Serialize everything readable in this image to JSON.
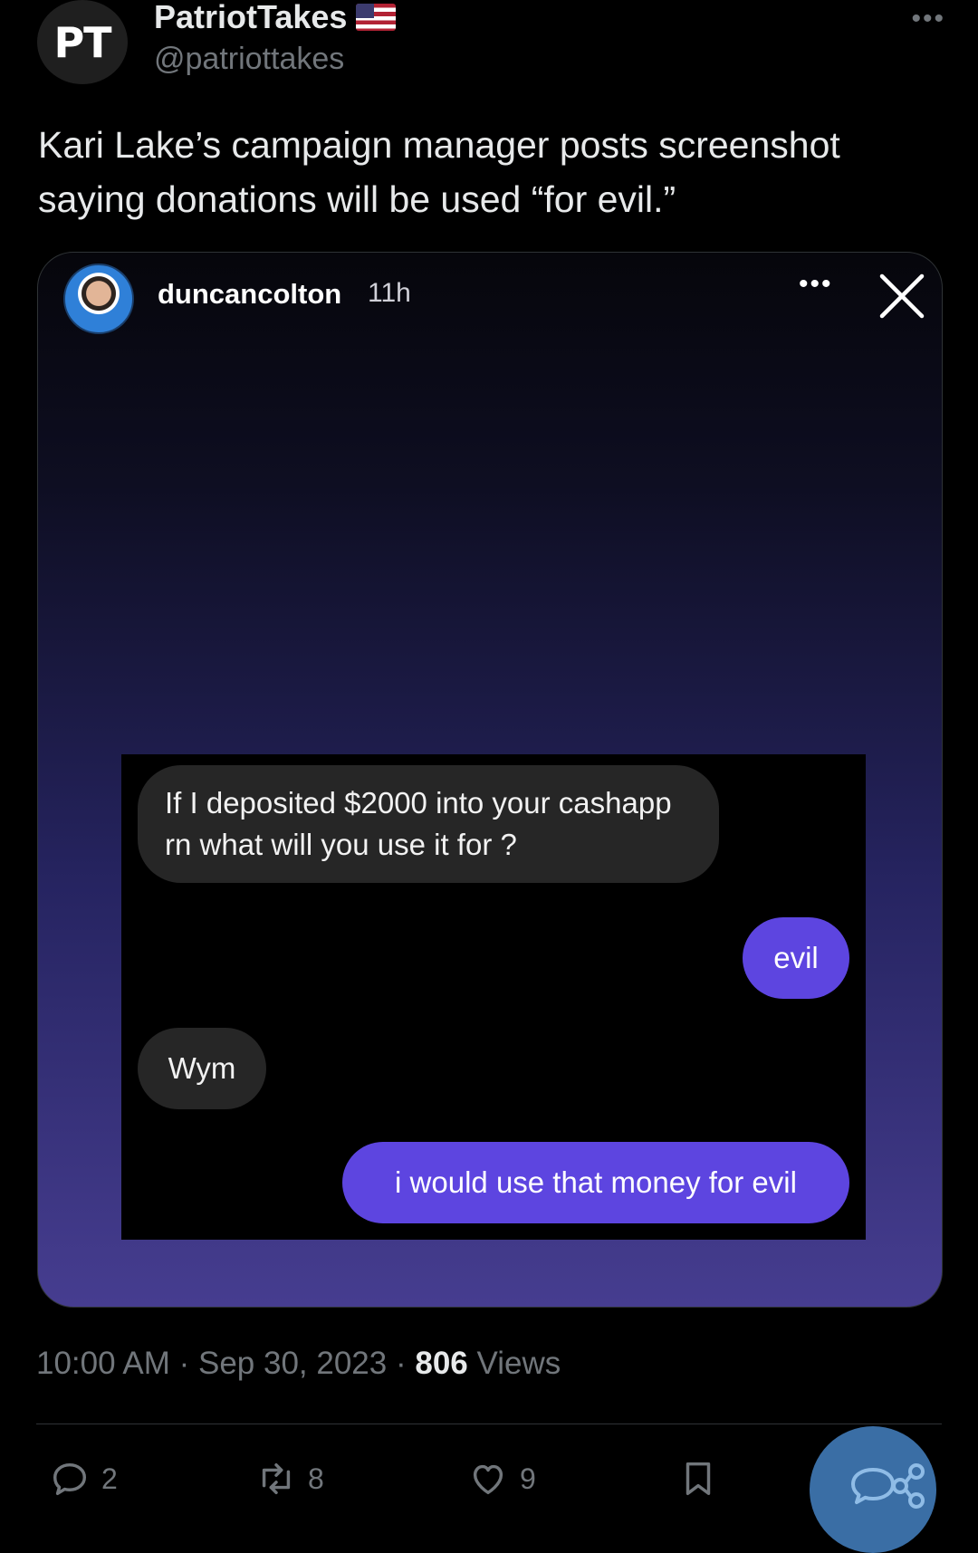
{
  "post": {
    "display_name": "PatriotTakes",
    "handle": "@patriottakes",
    "avatar_text": "PT",
    "more_glyph": "•••",
    "text": "Kari Lake’s campaign manager posts screenshot saying donations will be used “for evil.”"
  },
  "media": {
    "username": "duncancolton",
    "time": "11h",
    "more_glyph": "•••",
    "messages": [
      {
        "direction": "incoming",
        "text": "If I deposited $2000 into your cashapp rn what will you use it for ?"
      },
      {
        "direction": "outgoing",
        "text": "evil"
      },
      {
        "direction": "incoming",
        "text": "Wym"
      },
      {
        "direction": "outgoing",
        "text": "i would use that money for evil"
      }
    ]
  },
  "meta": {
    "time": "10:00 AM",
    "sep1": " · ",
    "date": "Sep 30, 2023",
    "sep2": " · ",
    "views_count": "806",
    "views_label": " Views"
  },
  "actions": {
    "replies": "2",
    "reposts": "8",
    "likes": "9"
  },
  "colors": {
    "background": "#000000",
    "outgoing_bubble": "#5d45e0",
    "incoming_bubble": "#262626",
    "fab": "#3a6ea5"
  },
  "icons": [
    "reply-icon",
    "repost-icon",
    "like-icon",
    "bookmark-icon",
    "share-icon",
    "close-icon",
    "flag-icon"
  ]
}
